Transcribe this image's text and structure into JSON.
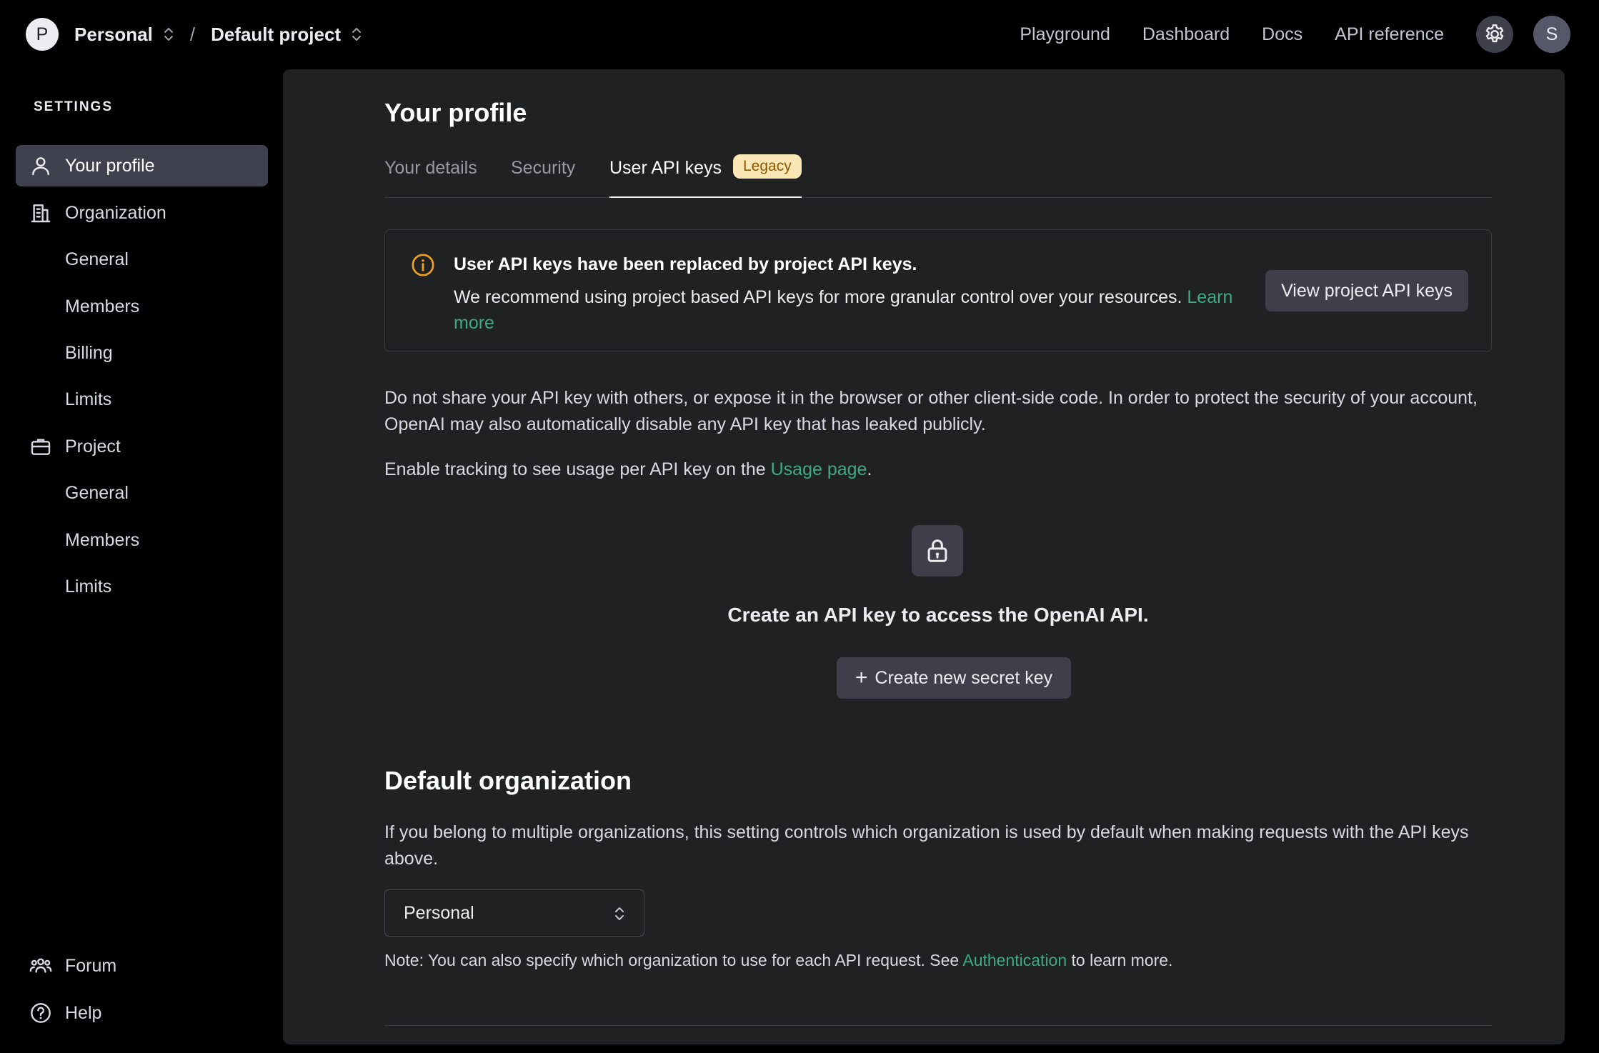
{
  "header": {
    "org_initial": "P",
    "org_name": "Personal",
    "separator": "/",
    "project_name": "Default project",
    "nav": [
      "Playground",
      "Dashboard",
      "Docs",
      "API reference"
    ],
    "user_initial": "S"
  },
  "sidebar": {
    "heading": "SETTINGS",
    "items": [
      {
        "label": "Your profile",
        "icon": "person-icon",
        "active": true
      },
      {
        "label": "Organization",
        "icon": "building-icon"
      },
      {
        "label": "General"
      },
      {
        "label": "Members"
      },
      {
        "label": "Billing"
      },
      {
        "label": "Limits"
      },
      {
        "label": "Project",
        "icon": "briefcase-icon"
      },
      {
        "label": "General"
      },
      {
        "label": "Members"
      },
      {
        "label": "Limits"
      }
    ],
    "footer": [
      {
        "label": "Forum",
        "icon": "people-icon"
      },
      {
        "label": "Help",
        "icon": "help-circle-icon"
      }
    ]
  },
  "main": {
    "title": "Your profile",
    "tabs": [
      {
        "label": "Your details"
      },
      {
        "label": "Security"
      },
      {
        "label": "User API keys",
        "badge": "Legacy",
        "active": true
      }
    ],
    "notice": {
      "title": "User API keys have been replaced by project API keys.",
      "text": "We recommend using project based API keys for more granular control over your resources.",
      "link": "Learn more",
      "button": "View project API keys"
    },
    "warning": "Do not share your API key with others, or expose it in the browser or other client-side code. In order to protect the security of your account, OpenAI may also automatically disable any API key that has leaked publicly.",
    "tracking": {
      "prefix": "Enable tracking to see usage per API key on the ",
      "link": "Usage page",
      "suffix": "."
    },
    "empty_state": {
      "title": "Create an API key to access the OpenAI API.",
      "button": "Create new secret key"
    },
    "default_org": {
      "title": "Default organization",
      "description": "If you belong to multiple organizations, this setting controls which organization is used by default when making requests with the API keys above.",
      "selected": "Personal",
      "note_prefix": "Note: You can also specify which organization to use for each API request. See ",
      "note_link": "Authentication",
      "note_suffix": " to learn more."
    }
  },
  "colors": {
    "accent_link": "#3ea987",
    "badge_bg": "#fbe7b5",
    "badge_text": "#8a5a00",
    "panel_bg": "#202123",
    "warning_icon": "#f0a020"
  }
}
